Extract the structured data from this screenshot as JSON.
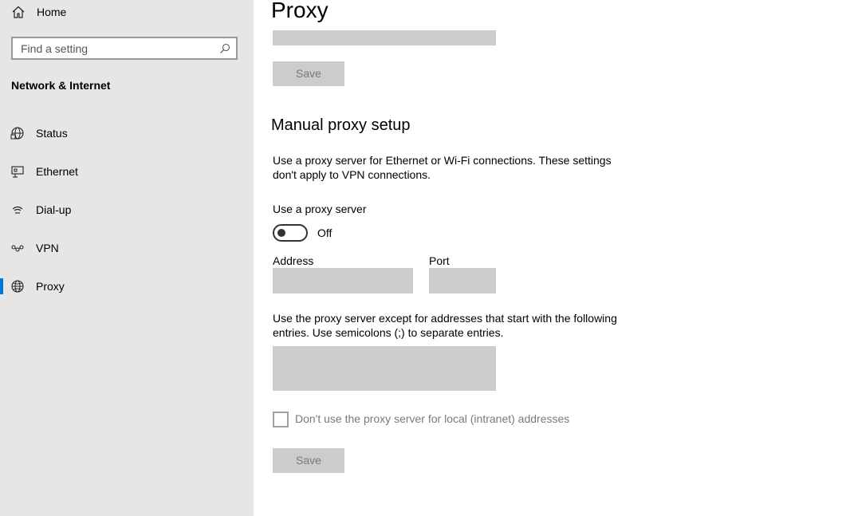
{
  "sidebar": {
    "home_label": "Home",
    "search_placeholder": "Find a setting",
    "section_title": "Network & Internet",
    "items": [
      {
        "label": "Status",
        "icon": "globe-status-icon"
      },
      {
        "label": "Ethernet",
        "icon": "ethernet-icon"
      },
      {
        "label": "Dial-up",
        "icon": "dial-up-icon"
      },
      {
        "label": "VPN",
        "icon": "vpn-icon"
      },
      {
        "label": "Proxy",
        "icon": "globe-icon",
        "selected": true
      }
    ]
  },
  "main": {
    "title": "Proxy",
    "top_save_label": "Save",
    "manual_heading": "Manual proxy setup",
    "manual_description": "Use a proxy server for Ethernet or Wi-Fi connections. These settings don't apply to VPN connections.",
    "use_proxy_label": "Use a proxy server",
    "toggle_state": "Off",
    "address_label": "Address",
    "address_value": "",
    "port_label": "Port",
    "port_value": "",
    "exceptions_description": "Use the proxy server except for addresses that start with the following entries. Use semicolons (;) to separate entries.",
    "exceptions_value": "",
    "local_checkbox_label": "Don't use the proxy server for local (intranet) addresses",
    "local_checkbox_checked": false,
    "bottom_save_label": "Save"
  },
  "colors": {
    "sidebar_bg": "#e6e6e6",
    "accent": "#0078d7",
    "disabled_fill": "#cccccc",
    "disabled_text": "#7a7a7a"
  }
}
